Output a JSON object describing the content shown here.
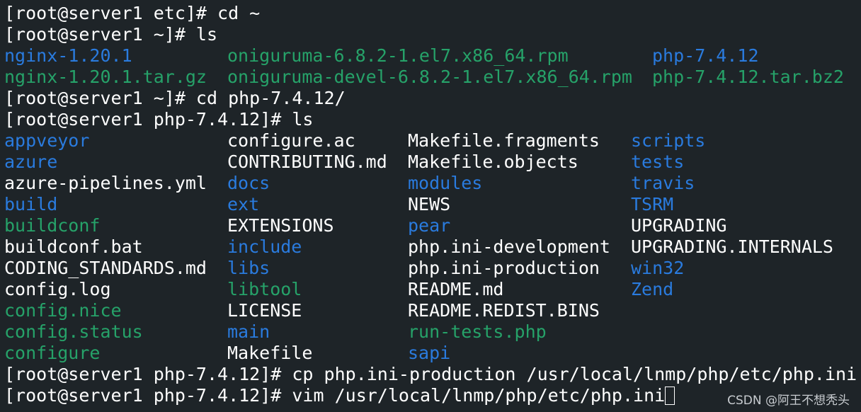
{
  "lines": [
    "[root@server1 etc]# cd ~",
    "[root@server1 ~]# ls",
    "[root@server1 ~]# cd php-7.4.12/",
    "[root@server1 php-7.4.12]# ls",
    "[root@server1 php-7.4.12]# cp php.ini-production /usr/local/lnmp/php/etc/php.ini",
    "[root@server1 php-7.4.12]# vim /usr/local/lnmp/php/etc/php.ini"
  ],
  "ls_home": [
    [
      {
        "text": "nginx-1.20.1",
        "color": "#2a7bde"
      },
      {
        "text": "oniguruma-6.8.2-1.el7.x86_64.rpm",
        "color": "#26a269"
      },
      {
        "text": "php-7.4.12",
        "color": "#2a7bde"
      }
    ],
    [
      {
        "text": "nginx-1.20.1.tar.gz",
        "color": "#26a269"
      },
      {
        "text": "oniguruma-devel-6.8.2-1.el7.x86_64.rpm",
        "color": "#26a269"
      },
      {
        "text": "php-7.4.12.tar.bz2",
        "color": "#26a269"
      }
    ]
  ],
  "ls_php": [
    [
      {
        "text": "appveyor",
        "color": "#2a7bde"
      },
      {
        "text": "configure.ac",
        "color": "#ffffff"
      },
      {
        "text": "Makefile.fragments",
        "color": "#ffffff"
      },
      {
        "text": "scripts",
        "color": "#2a7bde"
      }
    ],
    [
      {
        "text": "azure",
        "color": "#2a7bde"
      },
      {
        "text": "CONTRIBUTING.md",
        "color": "#ffffff"
      },
      {
        "text": "Makefile.objects",
        "color": "#ffffff"
      },
      {
        "text": "tests",
        "color": "#2a7bde"
      }
    ],
    [
      {
        "text": "azure-pipelines.yml",
        "color": "#ffffff"
      },
      {
        "text": "docs",
        "color": "#2a7bde"
      },
      {
        "text": "modules",
        "color": "#2a7bde"
      },
      {
        "text": "travis",
        "color": "#2a7bde"
      }
    ],
    [
      {
        "text": "build",
        "color": "#2a7bde"
      },
      {
        "text": "ext",
        "color": "#2a7bde"
      },
      {
        "text": "NEWS",
        "color": "#ffffff"
      },
      {
        "text": "TSRM",
        "color": "#2a7bde"
      }
    ],
    [
      {
        "text": "buildconf",
        "color": "#26a269"
      },
      {
        "text": "EXTENSIONS",
        "color": "#ffffff"
      },
      {
        "text": "pear",
        "color": "#2a7bde"
      },
      {
        "text": "UPGRADING",
        "color": "#ffffff"
      }
    ],
    [
      {
        "text": "buildconf.bat",
        "color": "#ffffff"
      },
      {
        "text": "include",
        "color": "#2a7bde"
      },
      {
        "text": "php.ini-development",
        "color": "#ffffff"
      },
      {
        "text": "UPGRADING.INTERNALS",
        "color": "#ffffff"
      }
    ],
    [
      {
        "text": "CODING_STANDARDS.md",
        "color": "#ffffff"
      },
      {
        "text": "libs",
        "color": "#2a7bde"
      },
      {
        "text": "php.ini-production",
        "color": "#ffffff"
      },
      {
        "text": "win32",
        "color": "#2a7bde"
      }
    ],
    [
      {
        "text": "config.log",
        "color": "#ffffff"
      },
      {
        "text": "libtool",
        "color": "#26a269"
      },
      {
        "text": "README.md",
        "color": "#ffffff"
      },
      {
        "text": "Zend",
        "color": "#2a7bde"
      }
    ],
    [
      {
        "text": "config.nice",
        "color": "#26a269"
      },
      {
        "text": "LICENSE",
        "color": "#ffffff"
      },
      {
        "text": "README.REDIST.BINS",
        "color": "#ffffff"
      },
      {
        "text": "",
        "color": "#ffffff"
      }
    ],
    [
      {
        "text": "config.status",
        "color": "#26a269"
      },
      {
        "text": "main",
        "color": "#2a7bde"
      },
      {
        "text": "run-tests.php",
        "color": "#26a269"
      },
      {
        "text": "",
        "color": "#ffffff"
      }
    ],
    [
      {
        "text": "configure",
        "color": "#26a269"
      },
      {
        "text": "Makefile",
        "color": "#ffffff"
      },
      {
        "text": "sapi",
        "color": "#2a7bde"
      },
      {
        "text": "",
        "color": "#ffffff"
      }
    ]
  ],
  "watermark": "CSDN @阿王不想秃头",
  "colors": {
    "background": "#1e2428",
    "dir": "#2a7bde",
    "exec": "#26a269",
    "text": "#ffffff"
  }
}
